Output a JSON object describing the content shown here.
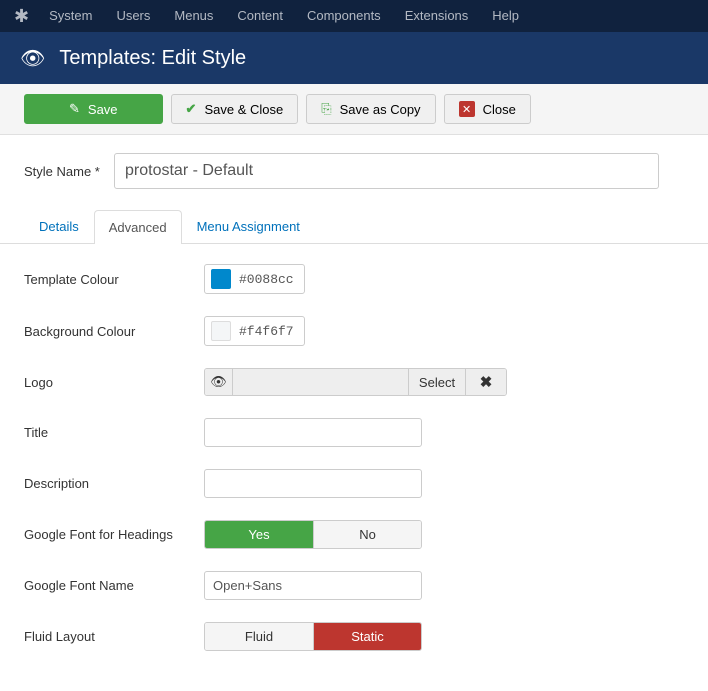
{
  "topnav": {
    "items": [
      "System",
      "Users",
      "Menus",
      "Content",
      "Components",
      "Extensions",
      "Help"
    ]
  },
  "header": {
    "title": "Templates: Edit Style"
  },
  "toolbar": {
    "save": "Save",
    "save_close": "Save & Close",
    "save_copy": "Save as Copy",
    "close": "Close"
  },
  "form": {
    "name_label": "Style Name *",
    "name_value": "protostar - Default"
  },
  "tabs": {
    "details": "Details",
    "advanced": "Advanced",
    "menu": "Menu Assignment"
  },
  "fields": {
    "template_colour": {
      "label": "Template Colour",
      "value": "#0088cc",
      "swatch": "#0088cc"
    },
    "bg_colour": {
      "label": "Background Colour",
      "value": "#f4f6f7",
      "swatch": "#f4f6f7"
    },
    "logo": {
      "label": "Logo",
      "select": "Select"
    },
    "title": {
      "label": "Title",
      "value": ""
    },
    "description": {
      "label": "Description",
      "value": ""
    },
    "gfont_headings": {
      "label": "Google Font for Headings",
      "yes": "Yes",
      "no": "No"
    },
    "gfont_name": {
      "label": "Google Font Name",
      "value": "Open+Sans"
    },
    "fluid": {
      "label": "Fluid Layout",
      "fluid": "Fluid",
      "static": "Static"
    }
  }
}
